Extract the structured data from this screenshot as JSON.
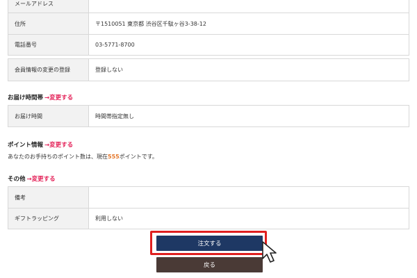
{
  "member_table": {
    "rows": [
      {
        "label": "メールアドレス",
        "value": ""
      },
      {
        "label": "住所",
        "value": "〒1510051 東京都 渋谷区千駄ヶ谷3-38-12"
      },
      {
        "label": "電話番号",
        "value": "03-5771-8700"
      }
    ]
  },
  "member_update": {
    "label": "会員情報の変更の登録",
    "value": "登録しない"
  },
  "delivery": {
    "title": "お届け時間帯",
    "change_link": "→変更する",
    "label": "お届け時間",
    "value": "時間帯指定無し"
  },
  "points": {
    "title": "ポイント情報",
    "change_link": "→変更する",
    "text_before": "あなたのお手持ちのポイント数は、現在",
    "amount": "555",
    "text_after": "ポイントです。"
  },
  "other": {
    "title": "その他",
    "change_link": "→変更する",
    "rows": [
      {
        "label": "備考",
        "value": ""
      },
      {
        "label": "ギフトラッピング",
        "value": "利用しない"
      }
    ]
  },
  "buttons": {
    "order": "注文する",
    "back": "戻る"
  },
  "colors": {
    "accent_link": "#e4245a",
    "order_button": "#1e3864",
    "back_button": "#4a3a36",
    "highlight": "#e02020",
    "points": "#e4762a"
  }
}
